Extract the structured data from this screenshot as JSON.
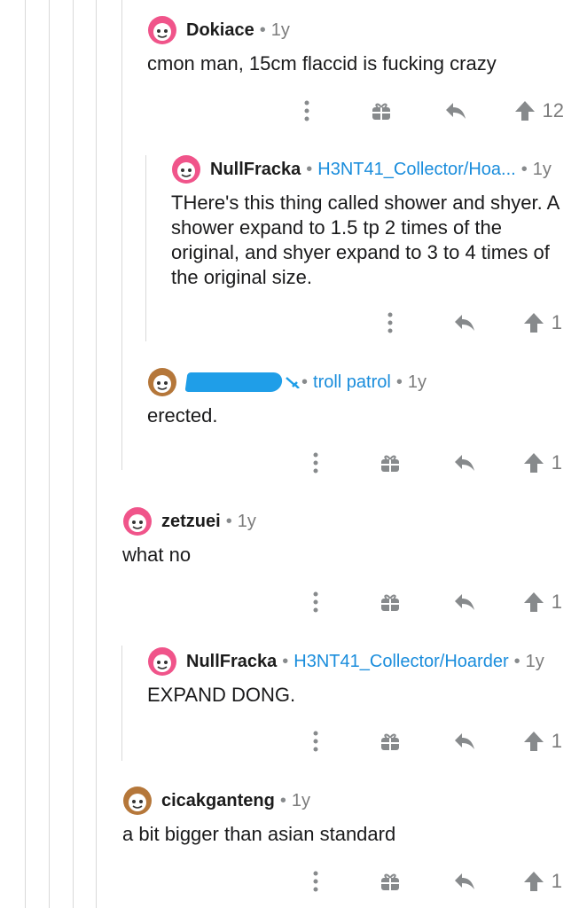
{
  "comments": [
    {
      "author": "Dokiace",
      "flair": "",
      "age": "1y",
      "text": "cmon man, 15cm flaccid is fucking crazy",
      "score": "12"
    },
    {
      "author": "NullFracka",
      "flair": "H3NT41_Collector/Hoa...",
      "age": "1y",
      "text": "THere's this thing called shower and shyer. A shower expand to 1.5 tp 2 times of the original, and shyer expand to 3 to 4 times of the original size.",
      "score": "1"
    },
    {
      "author": "",
      "flair": "troll patrol",
      "age": "1y",
      "text": "erected.",
      "score": "1"
    },
    {
      "author": "zetzuei",
      "flair": "",
      "age": "1y",
      "text": "what no",
      "score": "1"
    },
    {
      "author": "NullFracka",
      "flair": "H3NT41_Collector/Hoarder",
      "age": "1y",
      "text": "EXPAND DONG.",
      "score": "1"
    },
    {
      "author": "cicakganteng",
      "flair": "",
      "age": "1y",
      "text": "a bit bigger than asian standard",
      "score": "1"
    }
  ],
  "icons": {
    "avatar": "snoo-avatar-icon",
    "more": "more-options-icon",
    "award": "gift-award-icon",
    "reply": "reply-arrow-icon",
    "upvote": "upvote-arrow-icon"
  },
  "colors": {
    "flair": "#1a8ddc",
    "meta": "#7c7c7c",
    "thread_line": "#d9d9d9",
    "icon": "#878a8c",
    "avatar_pink": "#f0548a",
    "avatar_brown": "#b5773a"
  }
}
